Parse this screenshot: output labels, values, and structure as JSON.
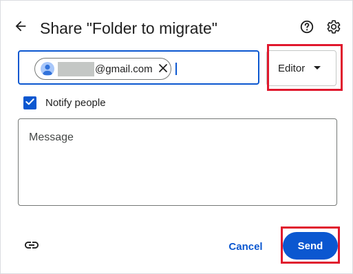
{
  "dialog": {
    "title": "Share \"Folder to migrate\"",
    "icons": {
      "back": "arrow-back-icon",
      "help": "help-icon",
      "settings": "gear-icon",
      "link": "link-icon"
    }
  },
  "recipients": {
    "chips": [
      {
        "email_suffix": "@gmail.com",
        "avatar_icon": "person-icon",
        "remove_icon": "close-icon"
      }
    ]
  },
  "role": {
    "selected": "Editor",
    "dropdown_icon": "caret-down-icon"
  },
  "notify": {
    "label": "Notify people",
    "checked": true
  },
  "message": {
    "placeholder": "Message"
  },
  "actions": {
    "cancel_label": "Cancel",
    "send_label": "Send"
  },
  "colors": {
    "accent": "#0b57d0",
    "highlight": "#e0182d"
  }
}
